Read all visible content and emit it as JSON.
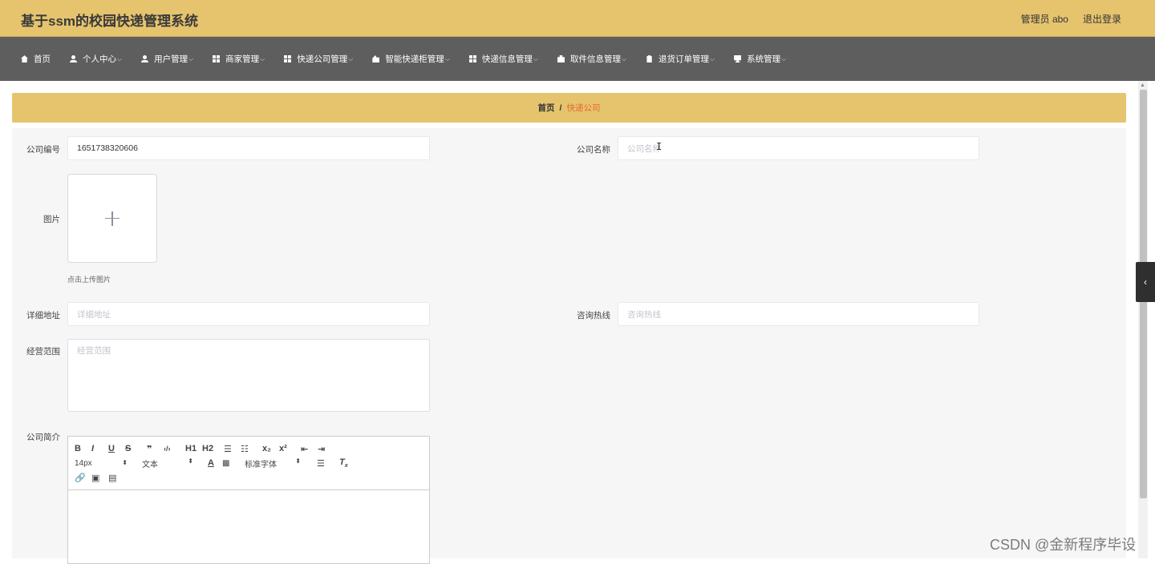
{
  "header": {
    "title": "基于ssm的校园快递管理系统",
    "user_label": "管理员 abo",
    "logout_label": "退出登录"
  },
  "nav": {
    "items": [
      {
        "label": "首页",
        "icon": "home-icon",
        "has_dropdown": false
      },
      {
        "label": "个人中心",
        "icon": "user-icon",
        "has_dropdown": true
      },
      {
        "label": "用户管理",
        "icon": "user-icon",
        "has_dropdown": true
      },
      {
        "label": "商家管理",
        "icon": "grid-icon",
        "has_dropdown": true
      },
      {
        "label": "快递公司管理",
        "icon": "grid-icon",
        "has_dropdown": true
      },
      {
        "label": "智能快递柜管理",
        "icon": "box-icon",
        "has_dropdown": true
      },
      {
        "label": "快递信息管理",
        "icon": "grid-icon",
        "has_dropdown": true
      },
      {
        "label": "取件信息管理",
        "icon": "briefcase-icon",
        "has_dropdown": true
      },
      {
        "label": "退货订单管理",
        "icon": "clipboard-icon",
        "has_dropdown": true
      },
      {
        "label": "系统管理",
        "icon": "monitor-icon",
        "has_dropdown": true
      }
    ]
  },
  "breadcrumb": {
    "home": "首页",
    "separator": "/",
    "current": "快递公司"
  },
  "form": {
    "company_no": {
      "label": "公司编号",
      "value": "1651738320606"
    },
    "company_name": {
      "label": "公司名称",
      "placeholder": "公司名称"
    },
    "image": {
      "label": "图片",
      "upload_tip": "点击上传图片"
    },
    "address": {
      "label": "详细地址",
      "placeholder": "详细地址"
    },
    "hotline": {
      "label": "咨询热线",
      "placeholder": "咨询热线"
    },
    "scope": {
      "label": "经营范围",
      "placeholder": "经营范围"
    },
    "intro": {
      "label": "公司简介"
    }
  },
  "editor": {
    "row1": [
      "B",
      "I",
      "U",
      "S",
      "❞",
      "‹/›",
      "H1",
      "H2",
      "☰",
      "☷",
      "x₂",
      "x²",
      "⇤",
      "⇥"
    ],
    "font_size": "14px",
    "block_type": "文本",
    "font_family": "标准字体"
  },
  "watermark": "CSDN @金新程序毕设",
  "colors": {
    "header_bg": "#e6c46e",
    "nav_bg": "#5e5e5e",
    "breadcrumb_current": "#e8692c"
  }
}
